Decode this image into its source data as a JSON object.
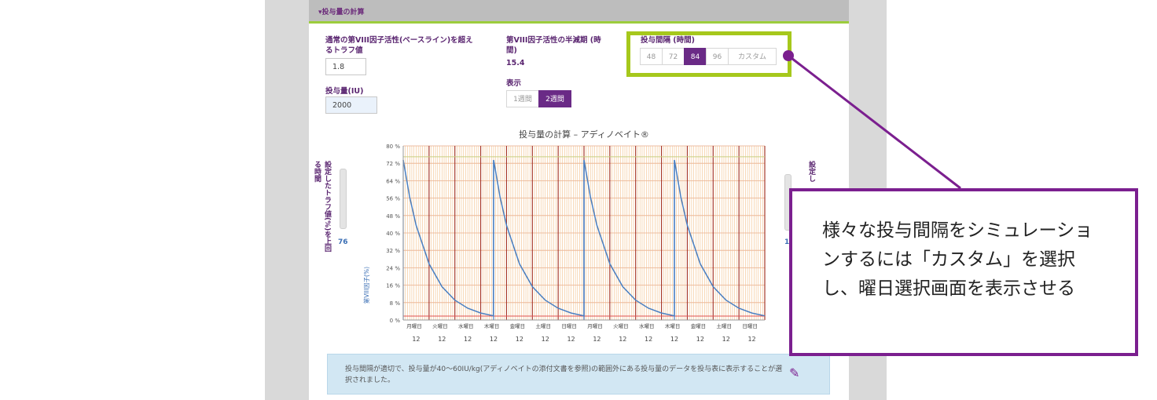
{
  "panel": {
    "title": "▾投与量の計算"
  },
  "fields": {
    "trough_label": "通常の第VIII因子活性(ベースライン)を超えるトラフ値",
    "trough_value": "1.8",
    "dose_label": "投与量(IU)",
    "dose_value": "2000",
    "halflife_label": "第VIII因子活性の半減期 (時間)",
    "halflife_value": "15.4",
    "interval_label": "投与間隔 (時間)",
    "interval_options": [
      "48",
      "72",
      "84",
      "96",
      "カスタム"
    ],
    "interval_selected": "84",
    "display_label": "表示",
    "display_options": [
      "1週間",
      "2週間"
    ],
    "display_selected": "2週間"
  },
  "sliders": {
    "left_label": "設定したトラフ値(%)を上回る時間",
    "left_value": "76",
    "right_label": "設定し",
    "right_value": "1"
  },
  "chart_data": {
    "type": "line",
    "title": "投与量の計算 – アディノベイト®",
    "ylabel": "第VIII因子(%)",
    "ylim": [
      0,
      80
    ],
    "yticks": [
      "0 %",
      "8 %",
      "16 %",
      "24 %",
      "32 %",
      "40 %",
      "48 %",
      "56 %",
      "64 %",
      "72 %",
      "80 %"
    ],
    "xlim": [
      0,
      14
    ],
    "x_day_labels": [
      "月曜日",
      "火曜日",
      "水曜日",
      "木曜日",
      "金曜日",
      "土曜日",
      "日曜日",
      "月曜日",
      "火曜日",
      "水曜日",
      "木曜日",
      "金曜日",
      "土曜日",
      "日曜日"
    ],
    "x_hour_labels": [
      "12",
      "12",
      "12",
      "12",
      "12",
      "12",
      "12",
      "12",
      "12",
      "12",
      "12",
      "12",
      "12",
      "12"
    ],
    "series": [
      {
        "x": [
          0,
          0.25,
          0.5,
          1,
          1.5,
          2,
          2.5,
          3,
          3.5,
          3.49,
          3.5,
          3.75,
          4,
          4.5,
          5,
          5.5,
          6,
          6.5,
          7,
          7,
          7.25,
          7.5,
          8,
          8.5,
          9,
          9.5,
          10,
          10.5,
          10.5,
          10.75,
          11,
          11.5,
          12,
          12.5,
          13,
          13.5,
          14
        ],
        "y": [
          73.5,
          56.5,
          43.5,
          25.8,
          15.3,
          9.1,
          5.4,
          3.2,
          1.9,
          1.9,
          73.5,
          56.5,
          43.5,
          25.8,
          15.3,
          9.1,
          5.4,
          3.2,
          1.9,
          73.5,
          56.5,
          43.5,
          25.8,
          15.3,
          9.1,
          5.4,
          3.2,
          1.9,
          73.5,
          56.5,
          43.5,
          25.8,
          15.3,
          9.1,
          5.4,
          3.2,
          1.9
        ]
      }
    ],
    "grid": true,
    "dose_lines_x": [
      0,
      3.5,
      7,
      10.5
    ],
    "day_lines_x": [
      1,
      2,
      3,
      4,
      5,
      6,
      7,
      8,
      9,
      10,
      11,
      12,
      13,
      14
    ]
  },
  "info": {
    "text": "投与間隔が適切で、投与量が40～60IU/kg(アディノベイトの添付文書を参照)の範囲外にある投与量のデータを投与表に表示することが選択されました。"
  },
  "callout": {
    "text": "様々な投与間隔をシミュレーションするには「カスタム」を選択し、曜日選択画面を表示させる"
  },
  "colors": {
    "accent": "#6a2a86",
    "highlight": "#a6c81c",
    "callout": "#7b1f8f",
    "curve": "#4a7fc1"
  }
}
